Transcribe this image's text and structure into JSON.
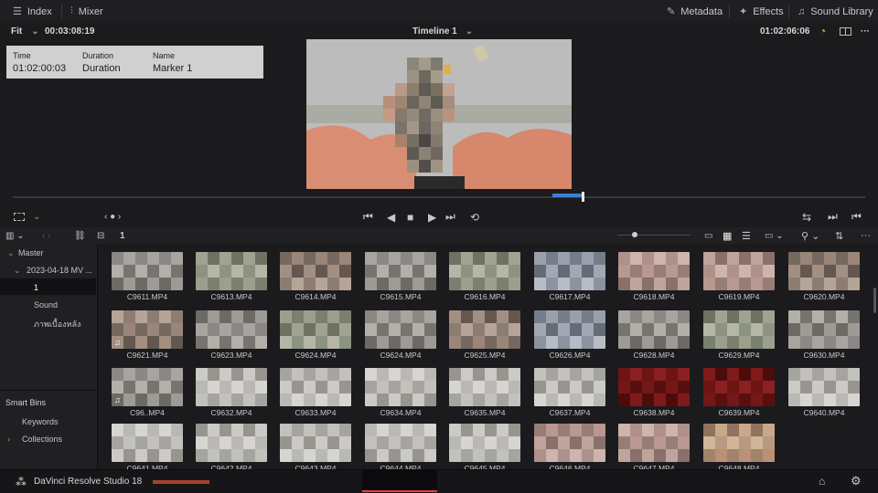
{
  "topbar": {
    "index_label": "Index",
    "mixer_label": "Mixer",
    "metadata_label": "Metadata",
    "effects_label": "Effects",
    "sound_library_label": "Sound Library"
  },
  "viewer_bar": {
    "zoom": "Fit",
    "source_timecode": "00:03:08:19",
    "timeline_name": "Timeline 1",
    "record_timecode": "01:02:06:06"
  },
  "marker": {
    "time_header": "Time",
    "duration_header": "Duration",
    "name_header": "Name",
    "time_value": "01:02:00:03",
    "duration_value": "Duration",
    "name_value": "Marker 1"
  },
  "pool_toolbar": {
    "bin_name": "1"
  },
  "sidebar": {
    "master_label": "Master",
    "bin_date": "2023-04-18 MV ...",
    "bin_1": "1",
    "bin_sound": "Sound",
    "bin_thai": "ภาพเบื้องหลัง",
    "smart_bins_label": "Smart Bins",
    "keywords_label": "Keywords",
    "collections_label": "Collections"
  },
  "clips": [
    {
      "name": "C9611.MP4",
      "tone": "gray"
    },
    {
      "name": "C9613.MP4",
      "tone": "green"
    },
    {
      "name": "C9614.MP4",
      "tone": "brown"
    },
    {
      "name": "C9615.MP4",
      "tone": "gray"
    },
    {
      "name": "C9616.MP4",
      "tone": "green"
    },
    {
      "name": "C9617.MP4",
      "tone": "blue"
    },
    {
      "name": "C9618.MP4",
      "tone": "pink"
    },
    {
      "name": "C9619.MP4",
      "tone": "pink"
    },
    {
      "name": "C9620.MP4",
      "tone": "brown"
    },
    {
      "name": "C9621.MP4",
      "tone": "brown",
      "badge": "♫"
    },
    {
      "name": "C9623.MP4",
      "tone": "gray"
    },
    {
      "name": "C9624.MP4",
      "tone": "green"
    },
    {
      "name": "C9624.MP4",
      "tone": "gray"
    },
    {
      "name": "C9625.MP4",
      "tone": "brown"
    },
    {
      "name": "C9626.MP4",
      "tone": "blue"
    },
    {
      "name": "C9628.MP4",
      "tone": "gray"
    },
    {
      "name": "C9629.MP4",
      "tone": "green"
    },
    {
      "name": "C9630.MP4",
      "tone": "gray"
    },
    {
      "name": "C96..MP4",
      "tone": "gray",
      "badge": "♫"
    },
    {
      "name": "C9632.MP4",
      "tone": "light"
    },
    {
      "name": "C9633.MP4",
      "tone": "light"
    },
    {
      "name": "C9634.MP4",
      "tone": "light"
    },
    {
      "name": "C9635.MP4",
      "tone": "light"
    },
    {
      "name": "C9637.MP4",
      "tone": "light"
    },
    {
      "name": "C9638.MP4",
      "tone": "red"
    },
    {
      "name": "C9639.MP4",
      "tone": "red"
    },
    {
      "name": "C9640.MP4",
      "tone": "light"
    },
    {
      "name": "C9641.MP4",
      "tone": "light"
    },
    {
      "name": "C9642.MP4",
      "tone": "light"
    },
    {
      "name": "C9643.MP4",
      "tone": "light"
    },
    {
      "name": "C9644.MP4",
      "tone": "light"
    },
    {
      "name": "C9645.MP4",
      "tone": "light"
    },
    {
      "name": "C9646.MP4",
      "tone": "pink"
    },
    {
      "name": "C9647.MP4",
      "tone": "pink"
    },
    {
      "name": "C9648.MP4",
      "tone": "orange"
    }
  ],
  "bottom": {
    "app_name": "DaVinci Resolve Studio 18"
  },
  "colors": {
    "accent_blue": "#3f7fd0",
    "page_active_red": "#e0443a"
  }
}
